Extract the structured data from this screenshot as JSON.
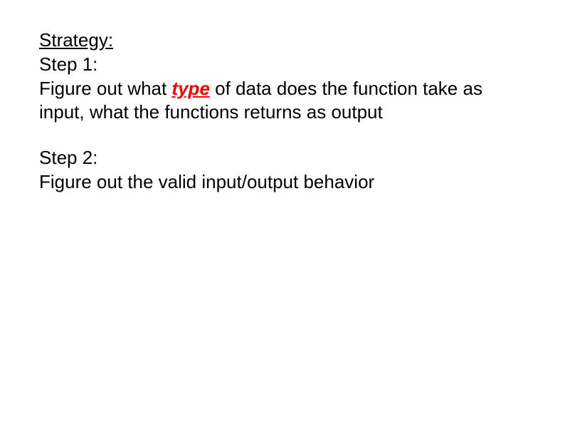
{
  "heading": "Strategy:",
  "step1": {
    "label": "Step 1:",
    "text_before": "Figure out what ",
    "type_word": "type",
    "text_after": " of data does the function take as input, what the functions returns as output"
  },
  "step2": {
    "label": "Step 2:",
    "text": "Figure out the valid input/output behavior"
  }
}
